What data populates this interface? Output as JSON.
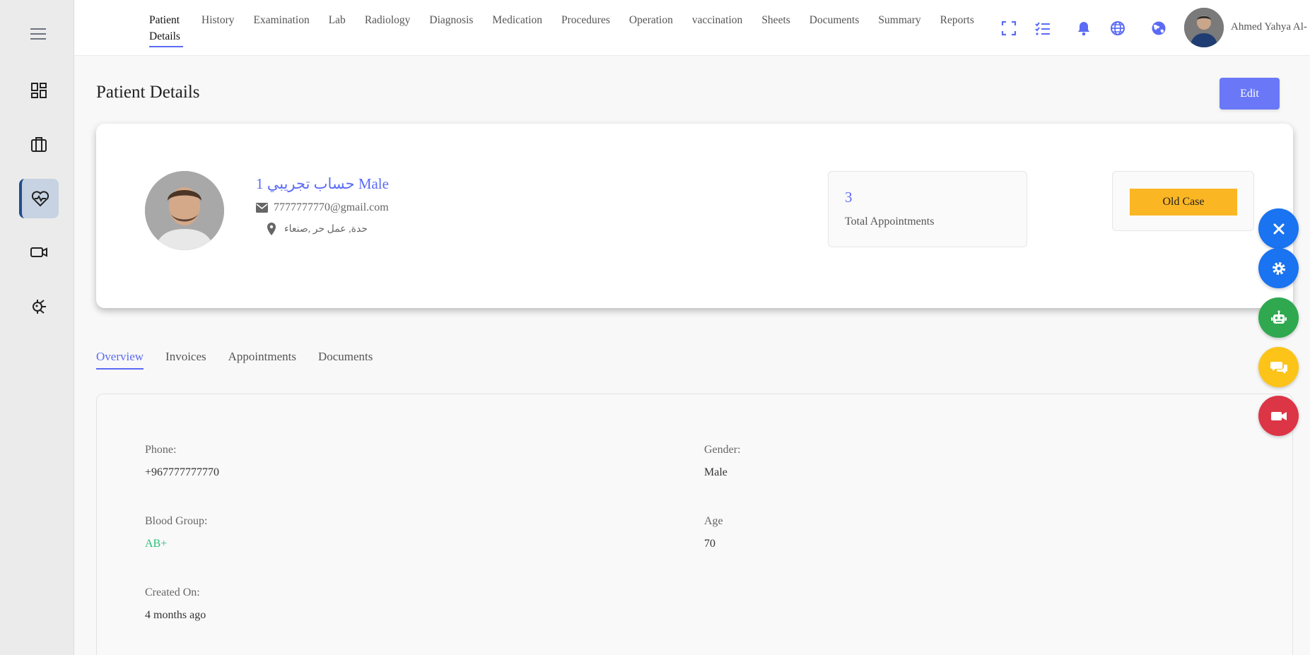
{
  "nav": {
    "items": [
      {
        "label": "Patient Details",
        "active": true
      },
      {
        "label": "History"
      },
      {
        "label": "Examination"
      },
      {
        "label": "Lab"
      },
      {
        "label": "Radiology"
      },
      {
        "label": "Diagnosis"
      },
      {
        "label": "Medication"
      },
      {
        "label": "Procedures"
      },
      {
        "label": "Operation"
      },
      {
        "label": "vaccination"
      },
      {
        "label": "Sheets"
      },
      {
        "label": "Documents"
      },
      {
        "label": "Summary"
      },
      {
        "label": "Reports"
      }
    ],
    "username": "Ahmed Yahya Al-"
  },
  "page": {
    "title": "Patient Details",
    "edit_label": "Edit"
  },
  "profile": {
    "name": "حساب تجريبي 1 Male",
    "email": "7777777770@gmail.com",
    "address": "حدة, عمل حر ,صنعاء",
    "appointments_count": "3",
    "appointments_label": "Total Appointments",
    "case_status": "Old Case",
    "case_color": "#fbb623"
  },
  "tabs": [
    {
      "label": "Overview",
      "active": true
    },
    {
      "label": "Invoices"
    },
    {
      "label": "Appointments"
    },
    {
      "label": "Documents"
    }
  ],
  "details": {
    "phone_label": "Phone:",
    "phone": "+967777777770",
    "gender_label": "Gender:",
    "gender": "Male",
    "blood_label": "Blood Group:",
    "blood": "AB+",
    "age_label": "Age",
    "age": "70",
    "created_label": "Created On:",
    "created": "4 months ago"
  },
  "colors": {
    "accent": "#5b6bf5",
    "fab_close": "#1a73f0",
    "fab_settings": "#1a73f0",
    "fab_bot": "#2fa84f",
    "fab_chat": "#fcc419",
    "fab_video": "#dc3545"
  }
}
